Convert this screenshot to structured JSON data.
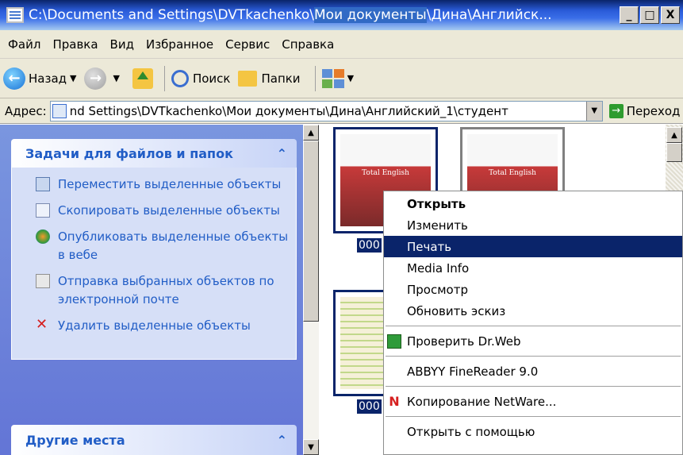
{
  "window": {
    "title_parts": [
      "C:\\Documents and Settings\\DVTkachenko\\",
      "Мои документы",
      "\\Дина\\",
      "Английск..."
    ],
    "minimize_label": "_",
    "maximize_label": "□",
    "close_label": "X"
  },
  "menu": [
    "Файл",
    "Правка",
    "Вид",
    "Избранное",
    "Сервис",
    "Справка"
  ],
  "toolbar": {
    "back_label": "Назад",
    "search_label": "Поиск",
    "folders_label": "Папки"
  },
  "address": {
    "label": "Адрес:",
    "value": "nd Settings\\DVTkachenko\\Мои документы\\Дина\\Английский_1\\студент",
    "go_label": "Переход"
  },
  "tasks": {
    "header": "Задачи для файлов и папок",
    "items": [
      {
        "label": "Переместить выделенные объекты",
        "icon": "move-icon"
      },
      {
        "label": "Скопировать выделенные объекты",
        "icon": "copy-icon"
      },
      {
        "label": "Опубликовать выделенные объекты в вебе",
        "icon": "publish-icon"
      },
      {
        "label": "Отправка выбранных объектов по электронной почте",
        "icon": "mail-icon"
      },
      {
        "label": "Удалить выделенные объекты",
        "icon": "delete-icon"
      }
    ]
  },
  "other_places": {
    "header": "Другие места"
  },
  "thumbnails": [
    {
      "book_title": "Total English",
      "filename": "000"
    },
    {
      "book_title": "Total English",
      "filename": ""
    },
    {
      "book_title": "",
      "filename": "000"
    }
  ],
  "context_menu": [
    {
      "label": "Открыть",
      "bold": true
    },
    {
      "label": "Изменить"
    },
    {
      "label": "Печать",
      "highlighted": true
    },
    {
      "label": "Media Info"
    },
    {
      "label": "Просмотр"
    },
    {
      "label": "Обновить эскиз"
    },
    {
      "separator": true
    },
    {
      "label": "Проверить Dr.Web",
      "icon": "drweb-icon"
    },
    {
      "separator": true
    },
    {
      "label": "ABBYY FineReader 9.0"
    },
    {
      "separator": true
    },
    {
      "label": "Копирование NetWare...",
      "icon": "netware-icon"
    },
    {
      "separator": true
    },
    {
      "label": "Открыть с помощью"
    }
  ]
}
